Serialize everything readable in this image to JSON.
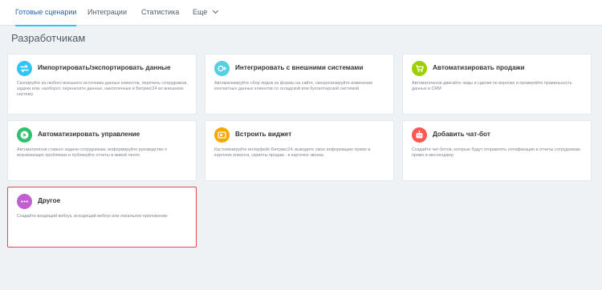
{
  "tabs": [
    {
      "label": "Готовые сценарии",
      "active": true
    },
    {
      "label": "Интеграции"
    },
    {
      "label": "Статистика"
    },
    {
      "label": "Еще"
    }
  ],
  "page_title": "Разработчикам",
  "cards": [
    {
      "title": "Импортировать/экспортировать данные",
      "description": "Скопируйте из любого внешнего источника данных клиентов, перечень сотрудников, задачи или, наоборот, перенесите данные, накопленные в Битрикс24 во внешнюю систему",
      "icon": "import-export-icon",
      "color": "#2fc6f6"
    },
    {
      "title": "Интегрировать с внешними системами",
      "description": "Автоматизируйте сбор лидов из формы на сайте, синхронизируйте изменение контактных данных клиентов со складской или бухгалтерской системой",
      "icon": "integration-icon",
      "color": "#55d0e0"
    },
    {
      "title": "Автоматизировать продажи",
      "description": "Автоматически двигайте лиды и сделки по воронке и проверяйте правильность данных в CRM",
      "icon": "cart-icon",
      "color": "#9dcf00"
    },
    {
      "title": "Автоматизировать управление",
      "description": "Автоматически ставьте задачи сотрудникам, информируйте руководство о возникающих проблемах и публикуйте отчеты в живой ленте",
      "icon": "play-icon",
      "color": "#2fc26e"
    },
    {
      "title": "Встроить виджет",
      "description": "Кастомизируйте интерфейс Битрикс24: выводите свою информацию прямо в карточке клиента, скрипты продаж - в карточке звонка",
      "icon": "widget-icon",
      "color": "#f7a700"
    },
    {
      "title": "Добавить чат-бот",
      "description": "Создайте чат-ботов, которые будут отправлять нотификации и отчеты сотрудникам прямо в мессенджер",
      "icon": "chatbot-icon",
      "color": "#ff5752"
    },
    {
      "title": "Другое",
      "description": "Создайте входящий вебхук, исходящий вебхук или локальное приложение",
      "icon": "more-icon",
      "color": "#c15fd2"
    }
  ]
}
